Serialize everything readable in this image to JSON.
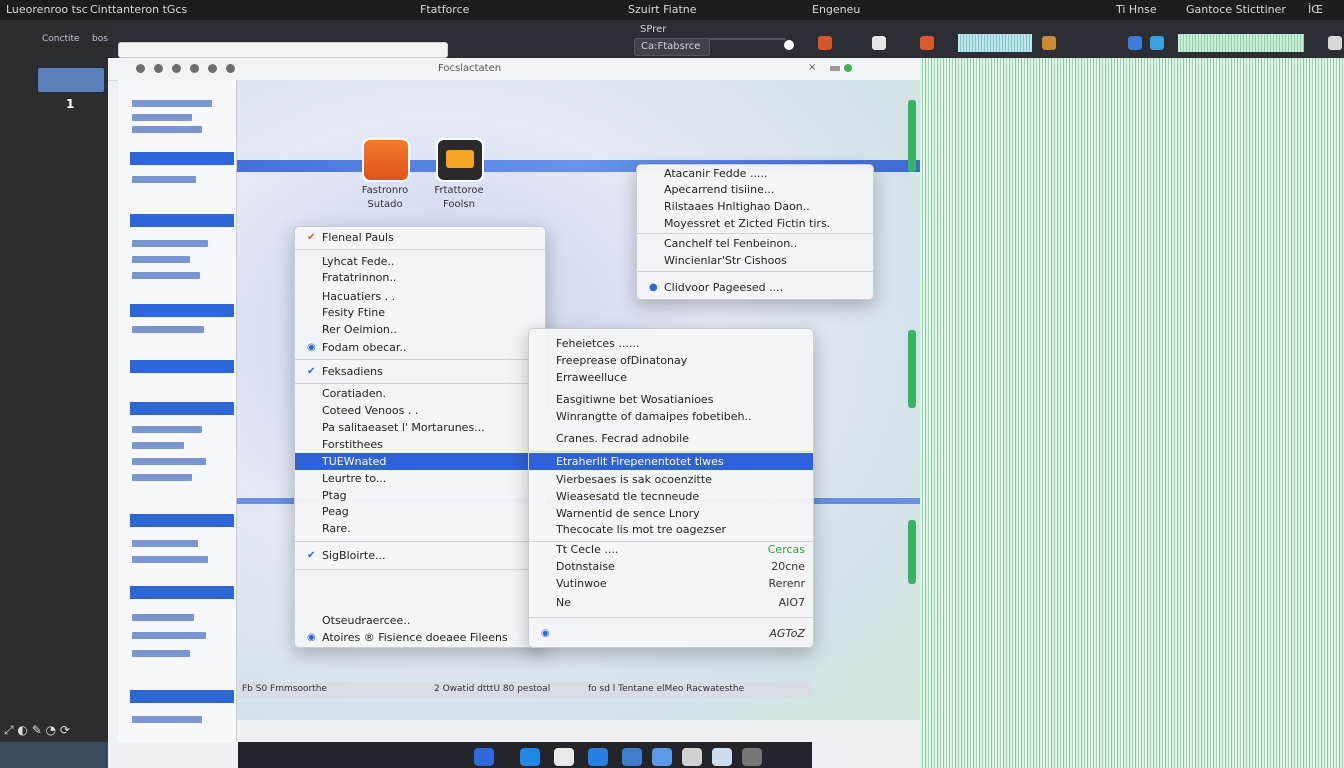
{
  "topbar": {
    "items": [
      "Lueorenroo tsc",
      "Cinttanteron tGcs",
      "Ftatforce",
      "Szuirt Fiatne",
      "Engeneu",
      "Ti Hnse",
      "Gantoce Sticttiner",
      "ÌŒ"
    ]
  },
  "toolbar": {
    "search_label": "Ca:Ftabsrce",
    "breadcrumb": "SPrer"
  },
  "leftrail": {
    "tabs": [
      "Conctite",
      "bos"
    ],
    "count": "1"
  },
  "window": {
    "title": "Focslactaten"
  },
  "desktop_icons": [
    {
      "label": "Fastronro\nSutado"
    },
    {
      "label": "Frtattoroe\nFoolsn"
    }
  ],
  "menu_left": {
    "items": [
      {
        "label": "Fleneal Pauls",
        "check": "✔"
      },
      {
        "label": "Lyhcat Fede..",
        "check": ""
      },
      {
        "label": "Fratatrinnon..",
        "check": ""
      },
      {
        "label": "Hacuatiers . .",
        "check": ""
      },
      {
        "label": "Fesity Ftine",
        "check": ""
      },
      {
        "label": "Rer Oeimion..",
        "check": ""
      },
      {
        "label": "Fodam obecar..",
        "check": ""
      },
      {
        "label": "Feksadiens",
        "check": "✔"
      },
      {
        "label": "Coratiaden.",
        "check": ""
      },
      {
        "label": "Coteed Venoos . .",
        "check": ""
      },
      {
        "label": "Pa salitaeaset l' Mortarunes...",
        "check": ""
      },
      {
        "label": "Forstithees",
        "check": ""
      },
      {
        "label": "TUEWnated",
        "check": "",
        "selected": true
      },
      {
        "label": "Leurtre to...",
        "check": ""
      },
      {
        "label": "Ptag",
        "check": ""
      },
      {
        "label": "Peag",
        "check": ""
      },
      {
        "label": "Rare.",
        "check": ""
      },
      {
        "label": "SigBloirte...",
        "check": "✔"
      },
      {
        "label": "Otseudraercee..",
        "check": ""
      },
      {
        "label": "Atoires ® Fisience doeaee Fileens",
        "check": ""
      }
    ]
  },
  "menu_top": {
    "items": [
      "Atacanir Fedde .....",
      "Apecarrend tisiine...",
      "Rilstaaes Hnltighao Daon..",
      "Moyessret et Zicted Fictin tirs.",
      "Canchelf tel Fenbeinon..",
      "Wincienlar'Str Cishoos",
      "Clidvoor Pageesed ...."
    ]
  },
  "menu_sub": {
    "items": [
      {
        "label": "Feheietces ......",
        "right": ""
      },
      {
        "label": "Freeprease ofDinatonay",
        "right": ""
      },
      {
        "label": "Erraweelluce",
        "right": ""
      },
      {
        "label": "Easgitiwne bet Wosatianioes",
        "right": ""
      },
      {
        "label": "Winrangtte of damaipes fobetibeh..",
        "right": ""
      },
      {
        "label": "Cranes. Fecrad adnobile",
        "right": ""
      },
      {
        "label": "Etraherlit Firepenentotet tiwes",
        "right": "",
        "selected": true
      },
      {
        "label": "Vierbesaes is sak ocoenzitte",
        "right": ""
      },
      {
        "label": "Wieasesatd tle tecnneude",
        "right": ""
      },
      {
        "label": "Warnentid de sence Lnory",
        "right": ""
      },
      {
        "label": "Thecocate lis mot tre oagezser",
        "right": ""
      },
      {
        "label": "Tt Cecle ....",
        "right": "Cercas"
      },
      {
        "label": "Dotnstaise",
        "right": "20cne"
      },
      {
        "label": "Vutinwoe",
        "right": "Rerenr"
      },
      {
        "label": "Ne",
        "right": "AIO7"
      },
      {
        "label": "",
        "right": "AGToZ"
      }
    ]
  },
  "statusbar": {
    "left": "Fb S0 Fmmsoorthe",
    "mid": "2 Owatid dtttU 80 pestoal",
    "right": "fo sd l Tentane elMeo Racwatesthe"
  },
  "colors": {
    "accent": "#2f62d6",
    "dock": "#23252a",
    "noise": "#9dd4b0"
  }
}
